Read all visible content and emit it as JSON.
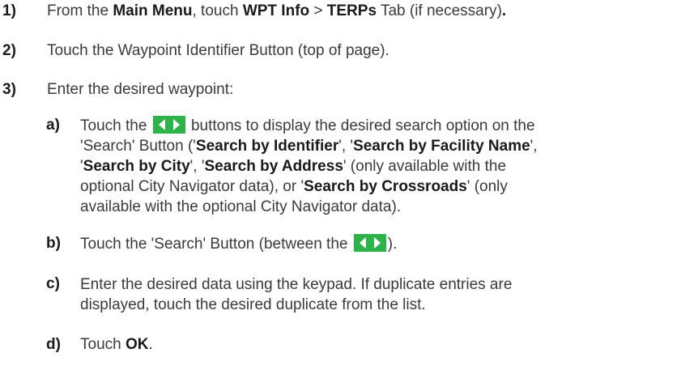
{
  "steps": [
    {
      "number": "1)",
      "parts": [
        "From the ",
        "Main Menu",
        ", touch ",
        "WPT Info",
        " > ",
        "TERPs",
        " Tab (if necessary)",
        "."
      ]
    },
    {
      "number": "2)",
      "text": "Touch the Waypoint Identifier Button (top of page)."
    },
    {
      "number": "3)",
      "text": "Enter the desired waypoint:"
    }
  ],
  "substeps": [
    {
      "letter": "a)",
      "line1_a": "Touch the ",
      "line1_b": " buttons to display the desired search option on the",
      "line2_a": "'Search' Button ('",
      "line2_b": "Search by Identifier",
      "line2_c": "', '",
      "line2_d": "Search by Facility Name",
      "line2_e": "',",
      "line3_a": "'",
      "line3_b": "Search by City",
      "line3_c": "',  '",
      "line3_d": "Search by Address",
      "line3_e": "' (only available with the",
      "line4_a": "optional City Navigator data), or '",
      "line4_b": "Search by Crossroads",
      "line4_c": "' (only",
      "line5": "available with the optional City Navigator data)."
    },
    {
      "letter": "b)",
      "text_a": "Touch the 'Search' Button (between the ",
      "text_b": ")."
    },
    {
      "letter": "c)",
      "line1": "Enter the desired data using the keypad.  If duplicate entries are",
      "line2": "displayed, touch the desired duplicate from the list."
    },
    {
      "letter": "d)",
      "text_a": "Touch ",
      "text_b": "OK",
      "text_c": "."
    }
  ],
  "colors": {
    "arrow_button": "#2db34a"
  },
  "icons": {
    "arrow_pair": "left-right-arrows-icon"
  }
}
